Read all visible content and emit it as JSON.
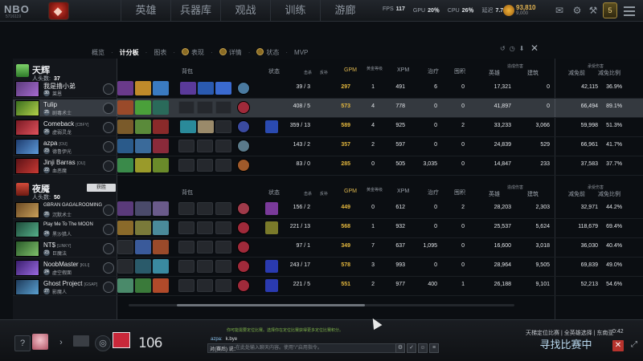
{
  "topbar": {
    "logo_text": "NBO",
    "logo_sub": "5716119",
    "nav": [
      "英雄",
      "兵器库",
      "观战",
      "训练",
      "游廊"
    ],
    "fps_label": "FPS",
    "fps": "117",
    "gpu_label": "GPU",
    "gpu": "20％",
    "cpu_label": "CPU",
    "cpu": "26％",
    "latency_label": "延迟",
    "latency": "7.7",
    "coins": "93,810",
    "coins_sub": "9,000",
    "level": "5"
  },
  "tabs": {
    "items": [
      "概览",
      "计分板",
      "图表",
      "表现",
      "详情",
      "状态",
      "MVP"
    ],
    "active_index": 1
  },
  "columns": {
    "backpack": "背包",
    "status": "状态",
    "kills": "击杀",
    "deaths": "反补",
    "gpm": "GPM",
    "net": "黄金等级",
    "xpm": "XPM",
    "heal": "治疗",
    "stack": "囤积",
    "dmg_group": "造成伤害",
    "hero_dmg": "英雄",
    "bld_dmg": "建筑",
    "taken_group": "承受伤害",
    "taken": "减免前",
    "ratio": "减免比例"
  },
  "radiant": {
    "name": "天辉",
    "kills_label": "人头数:",
    "kills": "37",
    "players": [
      {
        "name": "我是撸小弟",
        "tag": "",
        "level": "30",
        "hero": "莱恩",
        "kd": "39 / 3",
        "gpm": "297",
        "net": "1",
        "xpm": "491",
        "heal": "6",
        "stack": "0",
        "hero_dmg": "17,321",
        "bld_dmg": "0",
        "taken": "42,115",
        "ratio": "36.9%"
      },
      {
        "name": "Tulip",
        "tag": "",
        "level": "25",
        "hero": "剧毒术士",
        "kd": "408 / 5",
        "gpm": "573",
        "net": "4",
        "xpm": "778",
        "heal": "0",
        "stack": "0",
        "hero_dmg": "41,897",
        "bld_dmg": "0",
        "taken": "66,494",
        "ratio": "89.1%"
      },
      {
        "name": "Comeback",
        "tag": "[CBFY]",
        "level": "26",
        "hero": "虚弱灵龙",
        "kd": "359 / 13",
        "gpm": "589",
        "net": "4",
        "xpm": "925",
        "heal": "0",
        "stack": "2",
        "hero_dmg": "33,233",
        "bld_dmg": "3,066",
        "taken": "59,998",
        "ratio": "51.3%"
      },
      {
        "name": "azpa",
        "tag": "[OU]",
        "level": "23",
        "hero": "德鲁伊光",
        "kd": "143 / 2",
        "gpm": "357",
        "net": "2",
        "xpm": "597",
        "heal": "0",
        "stack": "0",
        "hero_dmg": "24,839",
        "bld_dmg": "529",
        "taken": "66,961",
        "ratio": "41.7%"
      },
      {
        "name": "Jinji Barras",
        "tag": "[OU]",
        "level": "22",
        "hero": "血恶魔",
        "kd": "83 / 0",
        "gpm": "285",
        "net": "0",
        "xpm": "505",
        "heal": "3,035",
        "stack": "0",
        "hero_dmg": "14,847",
        "bld_dmg": "233",
        "taken": "37,583",
        "ratio": "37.7%"
      }
    ]
  },
  "dire": {
    "name": "夜魇",
    "kills_label": "人头数:",
    "kills": "50",
    "tooltip": "获胜",
    "players": [
      {
        "name": "GBRAN GAGALROOMING",
        "tag": "",
        "level": "26",
        "hero": "沉默术士",
        "kd": "156 / 2",
        "gpm": "449",
        "net": "0",
        "xpm": "612",
        "heal": "0",
        "stack": "2",
        "hero_dmg": "28,203",
        "bld_dmg": "2,303",
        "taken": "32,971",
        "ratio": "44.2%"
      },
      {
        "name": "Play Me To The MOON",
        "tag": "[Moon]",
        "level": "24",
        "hero": "黑沙猎人",
        "kd": "221 / 13",
        "gpm": "568",
        "net": "1",
        "xpm": "932",
        "heal": "0",
        "stack": "0",
        "hero_dmg": "25,537",
        "bld_dmg": "5,624",
        "taken": "118,679",
        "ratio": "69.4%"
      },
      {
        "name": "NT$",
        "tag": "[LINKY]",
        "level": "23",
        "hero": "巨魔法",
        "kd": "97 / 1",
        "gpm": "349",
        "net": "7",
        "xpm": "637",
        "heal": "1,095",
        "stack": "0",
        "hero_dmg": "16,600",
        "bld_dmg": "3,018",
        "taken": "36,030",
        "ratio": "40.4%"
      },
      {
        "name": "NoobMaster",
        "tag": "[KILI]",
        "level": "24",
        "hero": "虚空假面",
        "kd": "243 / 17",
        "gpm": "578",
        "net": "3",
        "xpm": "993",
        "heal": "0",
        "stack": "0",
        "hero_dmg": "28,964",
        "bld_dmg": "9,505",
        "taken": "69,839",
        "ratio": "49.0%"
      },
      {
        "name": "Ghost Project",
        "tag": "[GSAP]",
        "level": "27",
        "hero": "影魔人",
        "kd": "221 / 5",
        "gpm": "551",
        "net": "2",
        "xpm": "977",
        "heal": "400",
        "stack": "1",
        "hero_dmg": "26,188",
        "bld_dmg": "9,101",
        "taken": "52,213",
        "ratio": "54.6%"
      }
    ]
  },
  "bottom": {
    "mmr": "106",
    "chat_hint": "你可能需要定位比赛。选择你在定位比赛获得更多定位比赛积分。",
    "chat_sender": "azpa:",
    "chat_message": "k.bye",
    "chat_prefix": "对(赛后) 说：",
    "chat_placeholder": "在此处输入聊天内容。使用\"/\"启用指令。",
    "mode_line": "天梯定位比赛 | 全英雄选择 | 东南亚",
    "timer": "0:42",
    "find_match": "寻找比赛中"
  }
}
